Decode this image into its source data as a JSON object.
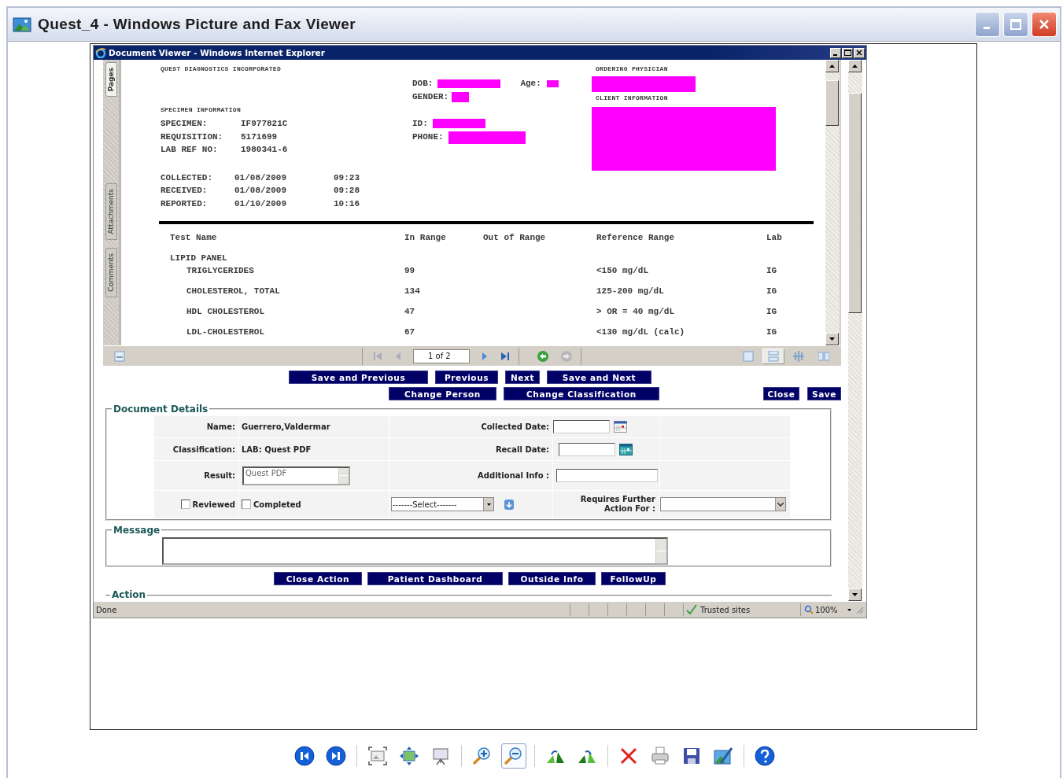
{
  "window": {
    "title": "Quest_4 - Windows Picture and Fax Viewer"
  },
  "browser": {
    "title": "Document Viewer - Windows Internet Explorer",
    "status": "Done",
    "zone": "Trusted sites",
    "zoom": "100%"
  },
  "viewer": {
    "side_tabs": [
      {
        "label": "Pages",
        "selected": true
      },
      {
        "label": "Attachments",
        "selected": false
      },
      {
        "label": "Comments",
        "selected": false
      }
    ],
    "page_field": "1 of 2",
    "view_modes": [
      {
        "kind": "single",
        "selected": false
      },
      {
        "kind": "continuous",
        "selected": true
      },
      {
        "kind": "grid",
        "selected": false
      },
      {
        "kind": "facing",
        "selected": false
      }
    ]
  },
  "document": {
    "header": "QUEST DIAGNOSTICS INCORPORATED",
    "specimen_heading": "SPECIMEN INFORMATION",
    "specimen": [
      {
        "label": "SPECIMEN:",
        "value": "IF977821C"
      },
      {
        "label": "REQUISITION:",
        "value": "5171699"
      },
      {
        "label": "LAB REF NO:",
        "value": "1980341-6"
      }
    ],
    "dates": [
      {
        "label": "COLLECTED:",
        "date": "01/08/2009",
        "time": "09:23"
      },
      {
        "label": "RECEIVED:",
        "date": "01/08/2009",
        "time": "09:28"
      },
      {
        "label": "REPORTED:",
        "date": "01/10/2009",
        "time": "10:16"
      }
    ],
    "dob_label": "DOB:",
    "age_label": "Age:",
    "gender_label": "GENDER:",
    "id_label": "ID:",
    "phone_label": "PHONE:",
    "physician_heading": "ORDERING PHYSICIAN",
    "client_heading": "CLIENT INFORMATION",
    "columns": [
      "Test Name",
      "In Range",
      "Out of Range",
      "Reference Range",
      "Lab"
    ],
    "panel": "LIPID PANEL",
    "results": [
      {
        "test": "TRIGLYCERIDES",
        "in_range": "99",
        "reference": "<150 mg/dL",
        "lab": "IG"
      },
      {
        "test": "CHOLESTEROL, TOTAL",
        "in_range": "134",
        "reference": "125-200 mg/dL",
        "lab": "IG"
      },
      {
        "test": "HDL CHOLESTEROL",
        "in_range": "47",
        "reference": "> OR = 40 mg/dL",
        "lab": "IG"
      },
      {
        "test": "LDL-CHOLESTEROL",
        "in_range": "67",
        "reference": "<130 mg/dL (calc)",
        "lab": "IG"
      }
    ]
  },
  "nav_buttons": [
    "Save and Previous",
    "Previous",
    "Next",
    "Save and Next"
  ],
  "edit_buttons": [
    "Change Person",
    "Change Classification"
  ],
  "save_buttons": [
    "Close",
    "Save"
  ],
  "details": {
    "legend": "Document Details",
    "name_label": "Name:",
    "name": "Guerrero,Valdermar",
    "classification_label": "Classification:",
    "classification": "LAB: Quest PDF",
    "result_label": "Result:",
    "result": "Quest PDF",
    "collected_label": "Collected Date:",
    "recall_label": "Recall Date:",
    "additional_label": "Additional Info :",
    "checks": [
      {
        "label": "Reviewed",
        "checked": false
      },
      {
        "label": "Completed",
        "checked": false
      }
    ],
    "select": "-------Select-------",
    "further_label": "Requires Further Action For :"
  },
  "message": {
    "legend": "Message"
  },
  "action_buttons": [
    "Close Action",
    "Patient Dashboard",
    "Outside Info",
    "FollowUp"
  ],
  "action_legend": "Action",
  "tools": [
    {
      "kind": "previous",
      "selected": false
    },
    {
      "kind": "next",
      "selected": false
    },
    {
      "kind": "separator"
    },
    {
      "kind": "best-fit",
      "selected": false
    },
    {
      "kind": "actual-size",
      "selected": false
    },
    {
      "kind": "slideshow",
      "selected": false
    },
    {
      "kind": "separator"
    },
    {
      "kind": "zoom-in",
      "selected": false
    },
    {
      "kind": "zoom-out",
      "selected": true
    },
    {
      "kind": "separator"
    },
    {
      "kind": "rotate-right",
      "selected": false
    },
    {
      "kind": "rotate-left",
      "selected": false
    },
    {
      "kind": "separator"
    },
    {
      "kind": "delete",
      "selected": false
    },
    {
      "kind": "print",
      "selected": false
    },
    {
      "kind": "save",
      "selected": false
    },
    {
      "kind": "edit",
      "selected": false
    },
    {
      "kind": "separator"
    },
    {
      "kind": "help",
      "selected": false
    }
  ]
}
